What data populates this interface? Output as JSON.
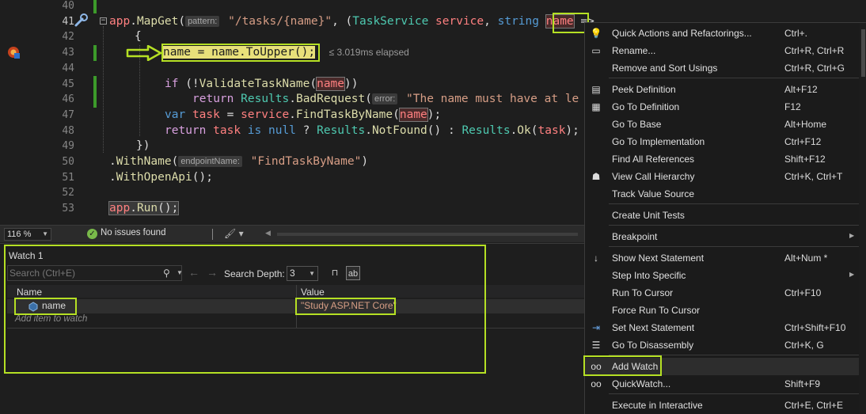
{
  "editor": {
    "line_numbers": [
      "40",
      "41",
      "42",
      "43",
      "44",
      "45",
      "46",
      "47",
      "48",
      "49",
      "50",
      "51",
      "52",
      "53"
    ],
    "current_line": "41",
    "line41": {
      "ident_app": "app",
      "dot": ".",
      "method_mapget": "MapGet",
      "open": "(",
      "hint_pattern": "pattern:",
      "route": "\"/tasks/{name}\"",
      "comma1": ", (",
      "type_taskservice": "TaskService",
      "param_service": "service",
      "comma2": ", ",
      "type_string": "string",
      "param_name": "name",
      "arrow": " =>"
    },
    "line42": "{",
    "line43": {
      "statement": "name = name.ToUpper();",
      "elapsed": "≤ 3.019ms elapsed"
    },
    "line45": {
      "kw_if": "if",
      "open": " (!",
      "method": "ValidateTaskName",
      "paren": "(",
      "arg": "name",
      "close": "))"
    },
    "line46": {
      "kw_return": "return",
      "cls_results": "Results",
      "dot": ".",
      "method": "BadRequest",
      "paren": "(",
      "hint_error": "error:",
      "text": "\"The name must have at le"
    },
    "line47": {
      "kw_var": "var",
      "ident_task": "task",
      "eq": " = ",
      "ident_service": "service",
      "dot": ".",
      "method": "FindTaskByName",
      "paren": "(",
      "arg": "name",
      "close": ");"
    },
    "line48": {
      "kw_return": "return",
      "ident_task": "task",
      "kw_is": "is",
      "kw_null": "null",
      "q": " ? ",
      "cls_results1": "Results",
      "dot1": ".",
      "method_notfound": "NotFound",
      "mid": "() : ",
      "cls_results2": "Results",
      "dot2": ".",
      "method_ok": "Ok",
      "paren": "(",
      "arg": "task",
      "close": ");"
    },
    "line49": "})",
    "line50": {
      "dot": ".",
      "method": "WithName",
      "paren": "(",
      "hint_endpoint": "endpointName:",
      "text": "\"FindTaskByName\"",
      "close": ")"
    },
    "line51": {
      "dot": ".",
      "method": "WithOpenApi",
      "close": "();"
    },
    "line53": {
      "ident_app": "app",
      "dot": ".",
      "method": "Run",
      "close": "();"
    }
  },
  "statusbar": {
    "zoom": "116 %",
    "issues": "No issues found"
  },
  "watch": {
    "title": "Watch 1",
    "search_placeholder": "Search (Ctrl+E)",
    "search_depth_label": "Search Depth:",
    "search_depth_value": "3",
    "columns": {
      "name": "Name",
      "value": "Value"
    },
    "rows": [
      {
        "name": "name",
        "value": "\"Study ASP.NET Core\""
      }
    ],
    "add_item": "Add item to watch"
  },
  "context_menu": {
    "items": [
      {
        "label": "Quick Actions and Refactorings...",
        "shortcut": "Ctrl+.",
        "icon": "lightbulb-icon"
      },
      {
        "label": "Rename...",
        "shortcut": "Ctrl+R, Ctrl+R",
        "icon": "rename-icon"
      },
      {
        "label": "Remove and Sort Usings",
        "shortcut": "Ctrl+R, Ctrl+G",
        "icon": ""
      },
      {
        "label": "Peek Definition",
        "shortcut": "Alt+F12",
        "icon": "peek-definition-icon"
      },
      {
        "label": "Go To Definition",
        "shortcut": "F12",
        "icon": "go-to-definition-icon"
      },
      {
        "label": "Go To Base",
        "shortcut": "Alt+Home",
        "icon": ""
      },
      {
        "label": "Go To Implementation",
        "shortcut": "Ctrl+F12",
        "icon": ""
      },
      {
        "label": "Find All References",
        "shortcut": "Shift+F12",
        "icon": ""
      },
      {
        "label": "View Call Hierarchy",
        "shortcut": "Ctrl+K, Ctrl+T",
        "icon": "call-hierarchy-icon"
      },
      {
        "label": "Track Value Source",
        "shortcut": "",
        "icon": ""
      },
      {
        "label": "Create Unit Tests",
        "shortcut": "",
        "icon": ""
      },
      {
        "label": "Breakpoint",
        "shortcut": "",
        "icon": "",
        "submenu": true
      },
      {
        "label": "Show Next Statement",
        "shortcut": "Alt+Num *",
        "icon": "arrow-down-icon"
      },
      {
        "label": "Step Into Specific",
        "shortcut": "",
        "icon": "",
        "submenu": true
      },
      {
        "label": "Run To Cursor",
        "shortcut": "Ctrl+F10",
        "icon": ""
      },
      {
        "label": "Force Run To Cursor",
        "shortcut": "",
        "icon": ""
      },
      {
        "label": "Set Next Statement",
        "shortcut": "Ctrl+Shift+F10",
        "icon": "set-next-statement-icon"
      },
      {
        "label": "Go To Disassembly",
        "shortcut": "Ctrl+K, G",
        "icon": "disassembly-icon"
      },
      {
        "label": "Add Watch",
        "shortcut": "",
        "icon": "glasses-icon"
      },
      {
        "label": "QuickWatch...",
        "shortcut": "Shift+F9",
        "icon": "glasses-icon"
      },
      {
        "label": "Execute in Interactive",
        "shortcut": "Ctrl+E, Ctrl+E",
        "icon": ""
      }
    ]
  },
  "colors": {
    "annotation_box": "#b5e024",
    "current_statement_bg": "#e8e07a",
    "change_margin": "#3c9a2a",
    "string_value": "#d69d85"
  }
}
